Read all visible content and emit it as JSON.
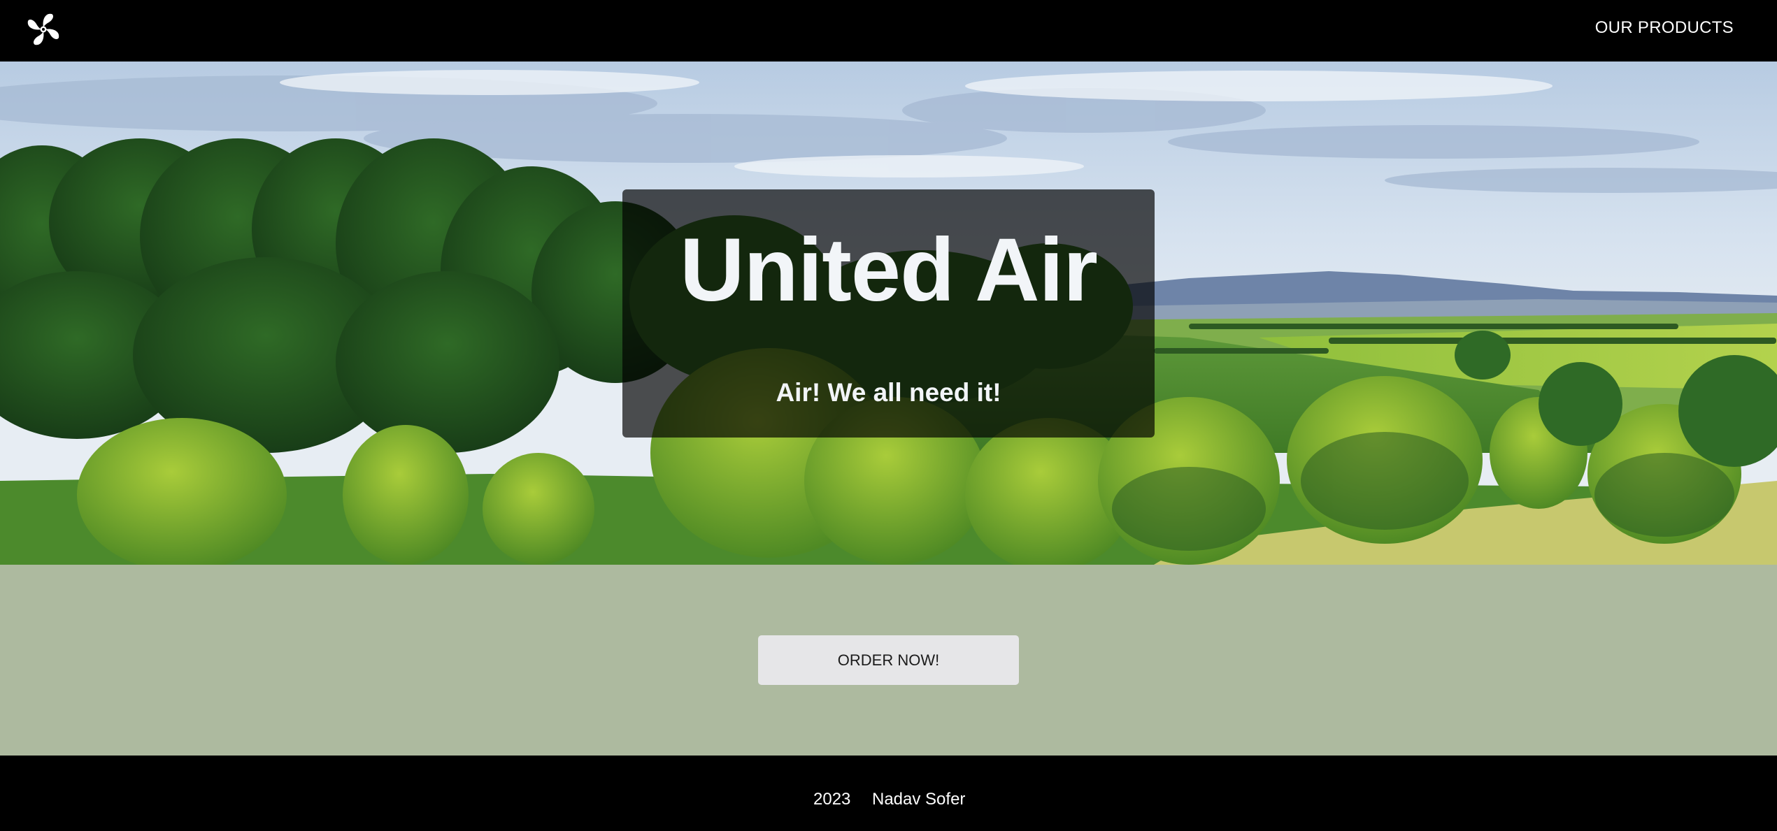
{
  "header": {
    "logo_icon": "fan-icon",
    "nav_link_label": "OUR PRODUCTS"
  },
  "hero": {
    "title": "United Air",
    "subtitle": "Air! We all need it!",
    "background": "landscape-photo-green-hills-trees"
  },
  "cta": {
    "button_label": "ORDER NOW!"
  },
  "footer": {
    "year": "2023",
    "author": "Nadav Sofer"
  },
  "colors": {
    "header_bg": "#000000",
    "cta_band_bg": "#adba9f",
    "button_bg": "#e6e6e8",
    "footer_bg": "#000000"
  }
}
